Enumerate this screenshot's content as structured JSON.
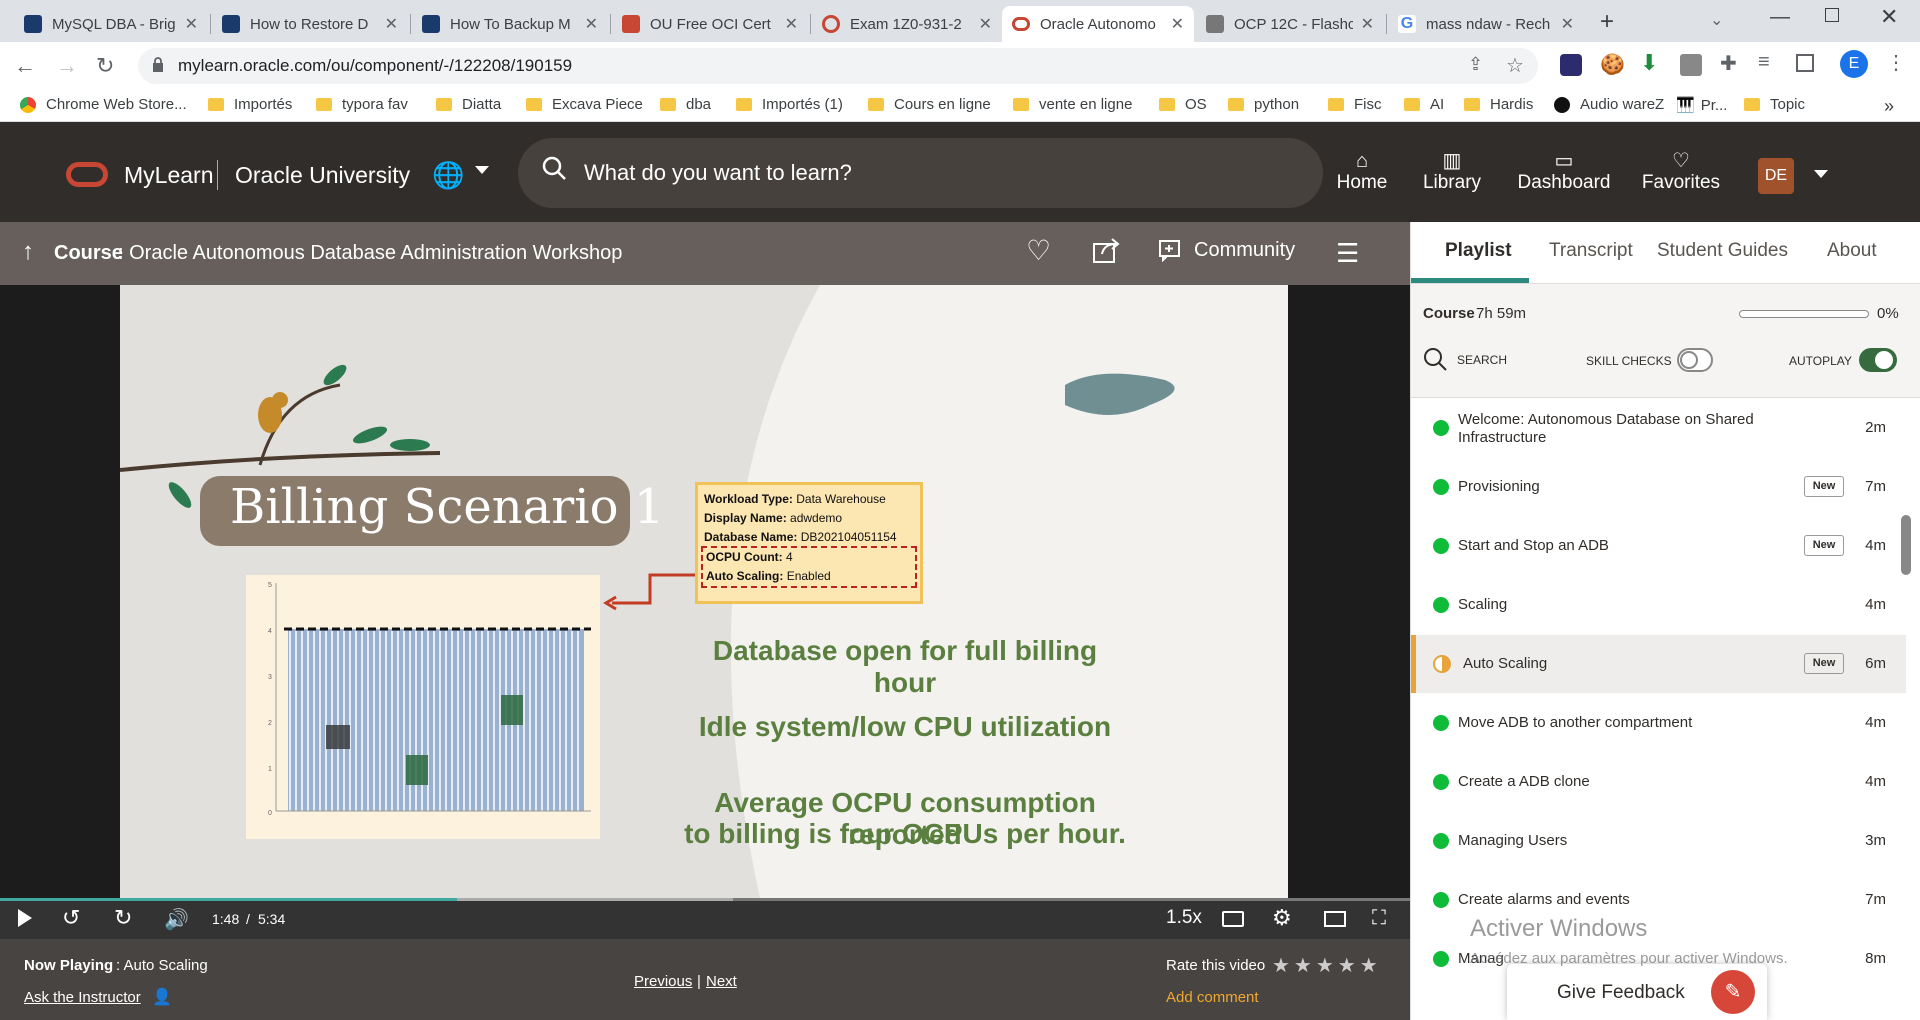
{
  "browser": {
    "tabs": [
      {
        "title": "MySQL DBA - Brig",
        "favicon_color": "#1a3a6b",
        "active": false
      },
      {
        "title": "How to Restore D",
        "favicon_color": "#1a3a6b",
        "active": false
      },
      {
        "title": "How To Backup M",
        "favicon_color": "#1a3a6b",
        "active": false
      },
      {
        "title": "OU Free OCI Cert",
        "favicon_color": "#c74634",
        "active": false
      },
      {
        "title": "Exam 1Z0-931-2",
        "favicon_color": "#c74634",
        "active": false
      },
      {
        "title": "Oracle Autonomo",
        "favicon_color": "#c74634",
        "active": true
      },
      {
        "title": "OCP 12C - Flashc",
        "favicon_color": "#777777",
        "active": false
      },
      {
        "title": "mass ndaw - Rech",
        "favicon_color": "#4285f4",
        "active": false
      }
    ],
    "url": "mylearn.oracle.com/ou/component/-/122208/190159",
    "profile_initial": "E",
    "bookmarks": [
      "Chrome Web Store...",
      "Importés",
      "typora fav",
      "Diatta",
      "Excava Piece",
      "dba",
      "Importés (1)",
      "Cours en ligne",
      "vente en ligne",
      "OS",
      "python",
      "Fisc",
      "AI",
      "Hardis",
      "Audio wareZ",
      "Pr...",
      "Topic"
    ]
  },
  "header": {
    "brand": "MyLearn",
    "org": "Oracle University",
    "search_placeholder": "What do you want to learn?",
    "nav": [
      {
        "label": "Home",
        "icon": "home-icon"
      },
      {
        "label": "Library",
        "icon": "library-icon"
      },
      {
        "label": "Dashboard",
        "icon": "dashboard-icon"
      },
      {
        "label": "Favorites",
        "icon": "heart-icon"
      }
    ],
    "avatar_initials": "DE"
  },
  "course": {
    "prefix": "Course",
    "title": ": Oracle Autonomous Database Administration Workshop",
    "community_label": "Community"
  },
  "slide": {
    "heading": "Billing Scenario 1",
    "info_box": [
      {
        "key": "Workload Type:",
        "value": "Data Warehouse"
      },
      {
        "key": "Display Name:",
        "value": "adwdemo"
      },
      {
        "key": "Database Name:",
        "value": "DB202104051154"
      },
      {
        "key": "OCPU Count:",
        "value": "4"
      },
      {
        "key": "Auto Scaling:",
        "value": "Enabled"
      }
    ],
    "line1": "Database open for full billing hour",
    "line2": "Idle system/low CPU utilization",
    "line3a": "Average OCPU consumption reported",
    "line3b": "to billing is four OCPUs per hour.",
    "chart_yticks": [
      "5",
      "4",
      "3",
      "2",
      "1",
      "0"
    ]
  },
  "player": {
    "current_time": "1:48",
    "separator": "/",
    "duration": "5:34",
    "speed": "1.5x",
    "progress": 0.324,
    "buffered": 0.52
  },
  "now_playing": {
    "prefix": "Now Playing",
    "title": ": Auto Scaling",
    "ask_instructor": "Ask the Instructor",
    "previous": "Previous",
    "sep": "|",
    "next": "Next",
    "rate_label": "Rate this video",
    "add_comment": "Add comment"
  },
  "panel": {
    "tabs": [
      "Playlist",
      "Transcript",
      "Student Guides",
      "About"
    ],
    "course_label": "Course",
    "course_duration": "7h 59m",
    "course_progress": "0%",
    "search_label": "SEARCH",
    "skill_checks_label": "SKILL CHECKS",
    "autoplay_label": "AUTOPLAY",
    "items": [
      {
        "title": "Welcome: Autonomous Database on Shared Infrastructure",
        "duration": "2m",
        "new": "",
        "state": "done"
      },
      {
        "title": "Provisioning",
        "duration": "7m",
        "new": "New",
        "state": "done"
      },
      {
        "title": "Start and Stop an ADB",
        "duration": "4m",
        "new": "New",
        "state": "done"
      },
      {
        "title": "Scaling",
        "duration": "4m",
        "new": "",
        "state": "done"
      },
      {
        "title": "Auto Scaling",
        "duration": "6m",
        "new": "New",
        "state": "current"
      },
      {
        "title": "Move ADB to another compartment",
        "duration": "4m",
        "new": "",
        "state": "done"
      },
      {
        "title": "Create a ADB clone",
        "duration": "4m",
        "new": "",
        "state": "done"
      },
      {
        "title": "Managing Users",
        "duration": "3m",
        "new": "",
        "state": "done"
      },
      {
        "title": "Create alarms and events",
        "duration": "7m",
        "new": "",
        "state": "done"
      },
      {
        "title": "Manag",
        "duration": "8m",
        "new": "",
        "state": "done"
      }
    ],
    "give_feedback": "Give Feedback"
  },
  "watermark": {
    "line1": "Activer Windows",
    "line2": "Accédez aux paramètres pour activer Windows."
  },
  "colors": {
    "oracle_red": "#c74634",
    "header_bg": "#312d2a",
    "done_green": "#0fbc3a",
    "current_orange": "#e8a33d",
    "slide_green": "#5a7f3f"
  }
}
